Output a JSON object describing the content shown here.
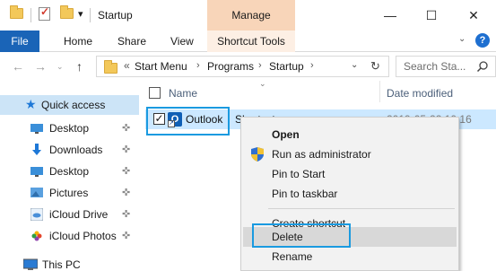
{
  "window": {
    "title": "Startup",
    "contextual_tab": "Manage",
    "minimize": "—",
    "maximize": "☐",
    "close": "✕"
  },
  "ribbon": {
    "file": "File",
    "tabs": [
      "Home",
      "Share",
      "View"
    ],
    "contextual_group": "Shortcut Tools",
    "help": "?"
  },
  "address_bar": {
    "overflow": "«",
    "crumbs": [
      "Start Menu",
      "Programs",
      "Startup"
    ],
    "separator": "›",
    "search_placeholder": "Search Sta..."
  },
  "nav_pane": {
    "quick_access": "Quick access",
    "items": [
      {
        "label": "Desktop",
        "icon": "desktop-icon"
      },
      {
        "label": "Downloads",
        "icon": "downloads-icon"
      },
      {
        "label": "Desktop",
        "icon": "desktop-icon"
      },
      {
        "label": "Pictures",
        "icon": "pictures-icon"
      },
      {
        "label": "iCloud Drive",
        "icon": "icloud-icon"
      },
      {
        "label": "iCloud Photos",
        "icon": "icloud-photos-icon"
      }
    ],
    "pin": "📌",
    "this_pc": "This PC"
  },
  "file_list": {
    "columns": [
      "Name",
      "Date modified"
    ],
    "rows": [
      {
        "name": "Outlook",
        "type": "Shortcut",
        "date": "2019-05-22 10:16"
      }
    ]
  },
  "context_menu": {
    "items": [
      "Open",
      "Run as administrator",
      "Pin to Start",
      "Pin to taskbar",
      "Create shortcut",
      "Delete",
      "Rename"
    ]
  },
  "colors": {
    "accent": "#1a64b7",
    "manage_tab": "#f8d5b9",
    "selection": "#cce8ff",
    "callout": "#1a9ae0"
  }
}
